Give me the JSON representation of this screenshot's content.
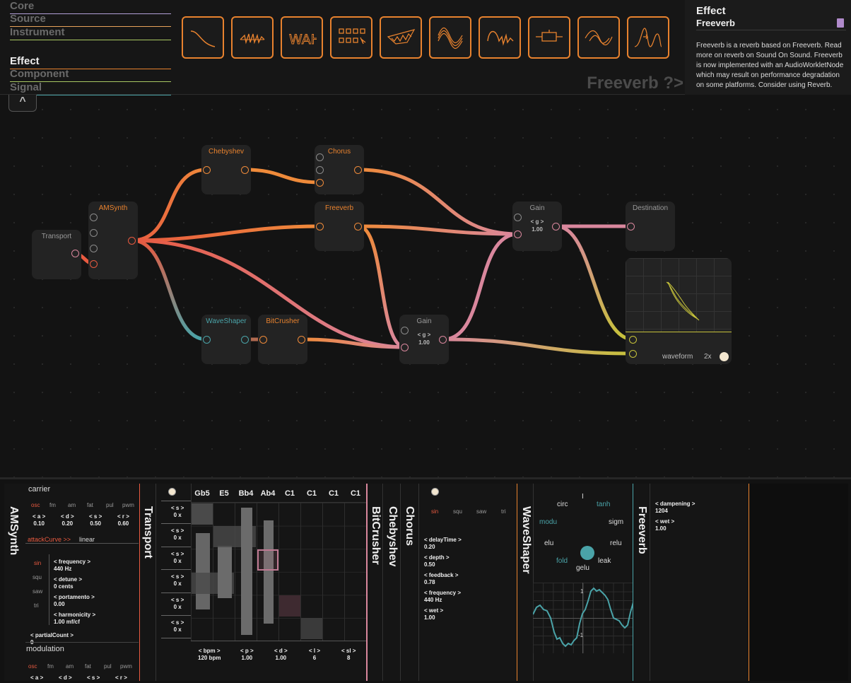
{
  "categories": [
    {
      "label": "Core",
      "color": "#b2a0d8",
      "active": false
    },
    {
      "label": "Source",
      "color": "#e6a25a",
      "active": false
    },
    {
      "label": "Instrument",
      "color": "#a8c862",
      "active": false
    },
    {
      "label": "Effect",
      "color": "#e8822e",
      "active": true
    },
    {
      "label": "Component",
      "color": "#a8c862",
      "active": false
    },
    {
      "label": "Signal",
      "color": "#4aa3a8",
      "active": false
    }
  ],
  "collapse_label": "^",
  "effect_tiles": [
    "autofilter-icon",
    "bitcrusher-icon",
    "autowah-icon",
    "stereo-widener-icon",
    "chebyshev-icon",
    "chorus-icon",
    "vibrato-icon",
    "distortion-icon",
    "feedback-delay-icon",
    "frequency-shifter-icon"
  ],
  "selected_title": "Freeverb ?>",
  "doc": {
    "category": "Effect",
    "name": "Freeverb",
    "text": "Freeverb is a reverb based on Freeverb. Read more on reverb on Sound On Sound. Freeverb is now implemented with an AudioWorkletNode which may result on performance degradation on some platforms. Consider using Reverb."
  },
  "nodes": {
    "transport": "Transport",
    "amsynth": "AMSynth",
    "chebyshev": "Chebyshev",
    "chorus": "Chorus",
    "freeverb": "Freeverb",
    "waveshaper": "WaveShaper",
    "bitcrusher": "BitCrusher",
    "gain1": {
      "title": "Gain",
      "param": "< g >",
      "value": "1.00"
    },
    "gain2": {
      "title": "Gain",
      "param": "< g >",
      "value": "1.00"
    },
    "destination": "Destination",
    "scope": {
      "label": "waveform",
      "mult": "2x"
    }
  },
  "amsynth": {
    "label": "AMSynth",
    "carrier_label": "carrier",
    "osc_tabs": [
      "osc",
      "fm",
      "am",
      "fat",
      "pul",
      "pwm"
    ],
    "envelope": [
      {
        "key": "< a >",
        "value": "0.10"
      },
      {
        "key": "< d >",
        "value": "0.20"
      },
      {
        "key": "< s >",
        "value": "0.50"
      },
      {
        "key": "< r >",
        "value": "0.60"
      }
    ],
    "attack_curve_key": "attackCurve >>",
    "attack_curve_value": "linear",
    "wave_tabs": [
      "sin",
      "squ",
      "saw",
      "tri"
    ],
    "params": [
      {
        "key": "< frequency >",
        "value": "440 Hz"
      },
      {
        "key": "< detune >",
        "value": "0 cents"
      },
      {
        "key": "< portamento >",
        "value": "0.00"
      },
      {
        "key": "< harmonicity >",
        "value": "1.00 mf/cf"
      }
    ],
    "partial_key": "< partialCount >",
    "partial_value": "0",
    "modulation_label": "modulation",
    "mod_tabs": [
      "osc",
      "fm",
      "am",
      "fat",
      "pul",
      "pwm"
    ],
    "mod_envelope": [
      "< a >",
      "< d >",
      "< s >",
      "< r >"
    ]
  },
  "transport": {
    "label": "Transport",
    "notes": [
      "Gb5",
      "E5",
      "Bb4",
      "Ab4",
      "C1",
      "C1",
      "C1",
      "C1"
    ],
    "rows": [
      {
        "key": "< s >",
        "value": "0 x"
      },
      {
        "key": "< s >",
        "value": "0 x"
      },
      {
        "key": "< s >",
        "value": "0 x"
      },
      {
        "key": "< s >",
        "value": "0 x"
      },
      {
        "key": "< s >",
        "value": "0 x"
      },
      {
        "key": "< s >",
        "value": "0 x"
      }
    ],
    "footer": [
      {
        "key": "< bpm >",
        "value": "120 bpm"
      },
      {
        "key": "< p >",
        "value": "1.00"
      },
      {
        "key": "< d >",
        "value": "1.00"
      },
      {
        "key": "< l >",
        "value": "6"
      },
      {
        "key": "< sl >",
        "value": "8"
      }
    ]
  },
  "labels": {
    "bitcrusher": "BitCrusher",
    "chebyshev": "Chebyshev",
    "chorus": "Chorus",
    "waveshaper": "WaveShaper",
    "freeverb": "Freeverb"
  },
  "chorus": {
    "wave_tabs": [
      "sin",
      "squ",
      "saw",
      "tri"
    ],
    "params": [
      {
        "key": "< delayTime >",
        "value": "0.20"
      },
      {
        "key": "< depth >",
        "value": "0.50"
      },
      {
        "key": "< feedback >",
        "value": "0.78"
      },
      {
        "key": "< frequency >",
        "value": "440 Hz"
      },
      {
        "key": "< wet >",
        "value": "1.00"
      }
    ]
  },
  "waveshaper": {
    "cursor": "I",
    "words": [
      "circ",
      "tanh",
      "modu",
      "sigm",
      "elu",
      "relu",
      "fold",
      "leak",
      "gelu"
    ],
    "axis_top": "1",
    "axis_bottom": "-1"
  },
  "freeverb": {
    "params": [
      {
        "key": "< dampening >",
        "value": "1204"
      },
      {
        "key": "< wet >",
        "value": "1.00"
      }
    ]
  },
  "colors": {
    "effect": "#e8822e",
    "teal": "#4aa3a8",
    "pink": "#d9879d",
    "red": "#e85a40",
    "yellow": "#c6c23a"
  }
}
